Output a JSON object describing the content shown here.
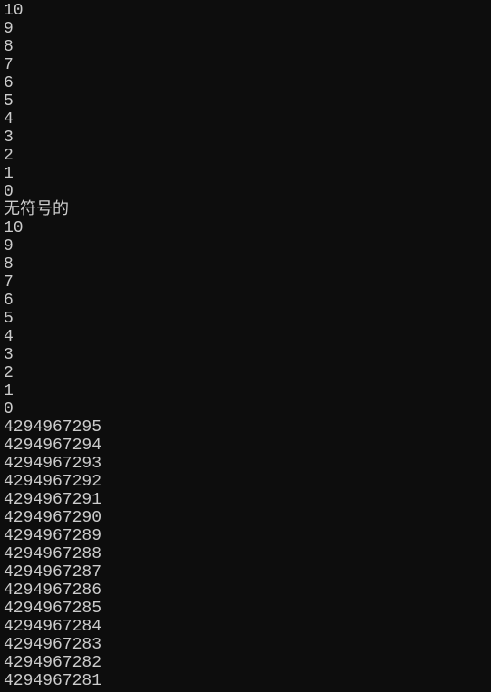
{
  "lines": [
    "10",
    "9",
    "8",
    "7",
    "6",
    "5",
    "4",
    "3",
    "2",
    "1",
    "0",
    "无符号的",
    "10",
    "9",
    "8",
    "7",
    "6",
    "5",
    "4",
    "3",
    "2",
    "1",
    "0",
    "4294967295",
    "4294967294",
    "4294967293",
    "4294967292",
    "4294967291",
    "4294967290",
    "4294967289",
    "4294967288",
    "4294967287",
    "4294967286",
    "4294967285",
    "4294967284",
    "4294967283",
    "4294967282",
    "4294967281"
  ]
}
